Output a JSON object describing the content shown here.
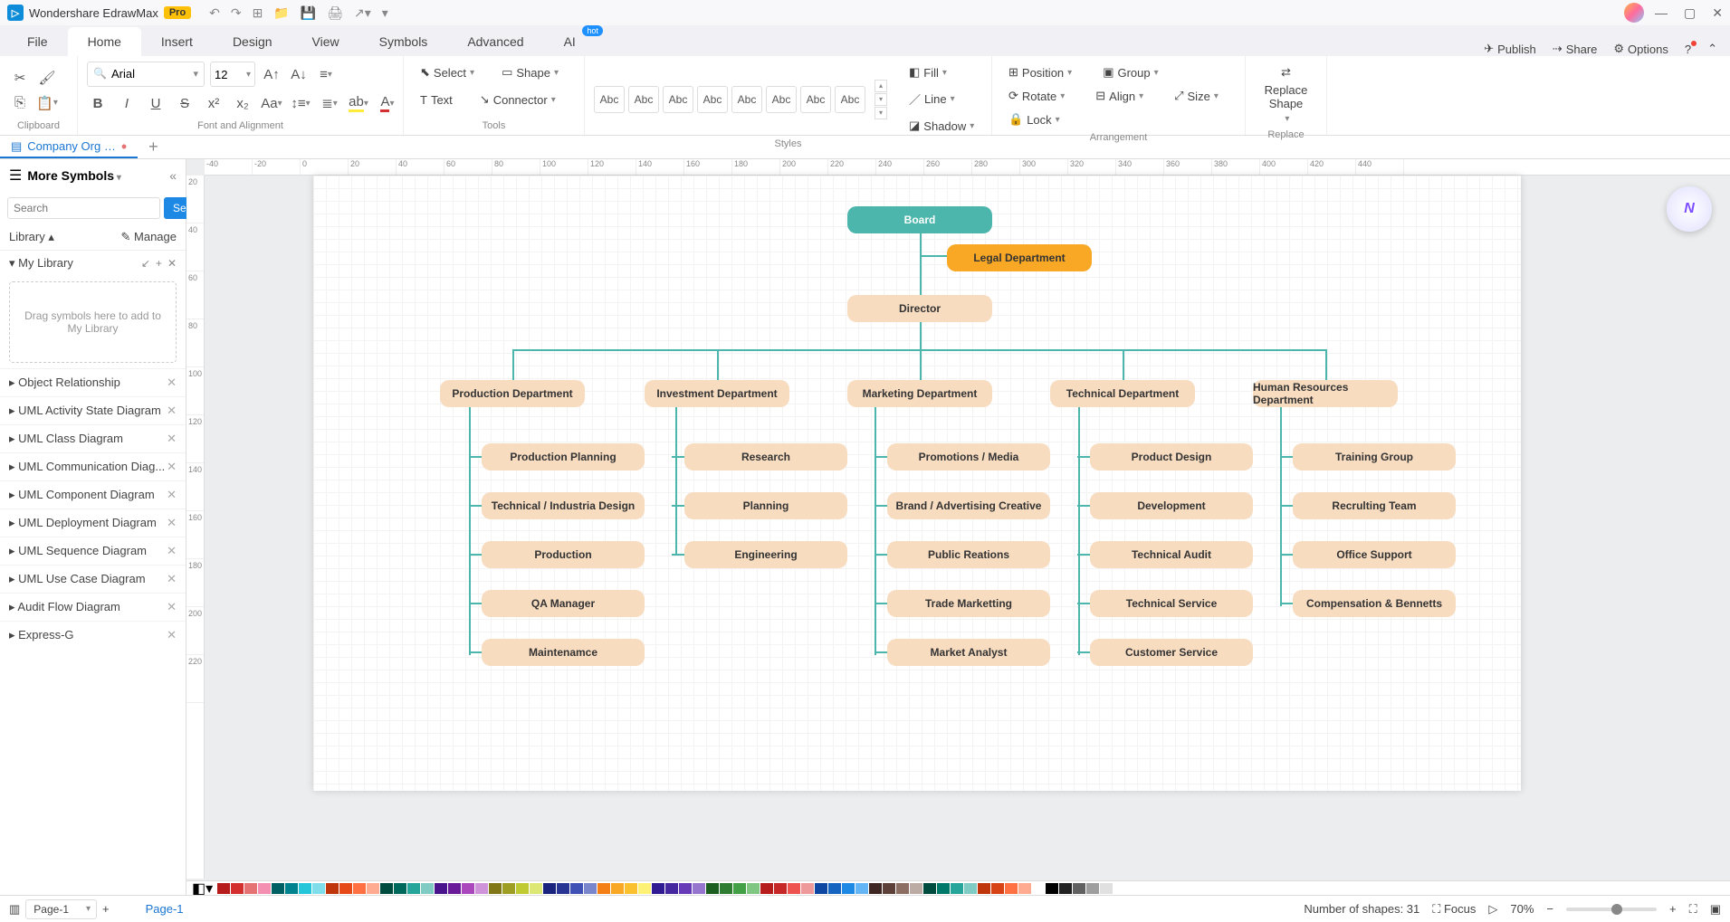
{
  "titlebar": {
    "app_name": "Wondershare EdrawMax",
    "pro": "Pro"
  },
  "menu": {
    "file": "File",
    "home": "Home",
    "insert": "Insert",
    "design": "Design",
    "view": "View",
    "symbols": "Symbols",
    "advanced": "Advanced",
    "ai": "AI",
    "hot": "hot",
    "publish": "Publish",
    "share": "Share",
    "options": "Options"
  },
  "ribbon": {
    "font_name": "Arial",
    "font_size": "12",
    "clipboard": "Clipboard",
    "font_align": "Font and Alignment",
    "tools": "Tools",
    "styles": "Styles",
    "arrangement": "Arrangement",
    "replace": "Replace",
    "select": "Select",
    "shape": "Shape",
    "text": "Text",
    "connector": "Connector",
    "fill": "Fill",
    "line": "Line",
    "shadow": "Shadow",
    "position": "Position",
    "group": "Group",
    "rotate": "Rotate",
    "align": "Align",
    "size": "Size",
    "lock": "Lock",
    "replace_shape": "Replace\nShape",
    "abc": "Abc"
  },
  "doctab": {
    "name": "Company Org …"
  },
  "sidebar": {
    "title": "More Symbols",
    "search_ph": "Search",
    "search_btn": "Search",
    "library": "Library",
    "manage": "Manage",
    "mylib": "My Library",
    "drop_hint": "Drag symbols here to add to My Library",
    "items": [
      "Object Relationship",
      "UML Activity State Diagram",
      "UML Class Diagram",
      "UML Communication Diag...",
      "UML Component Diagram",
      "UML Deployment Diagram",
      "UML Sequence Diagram",
      "UML Use Case Diagram",
      "Audit Flow Diagram",
      "Express-G"
    ]
  },
  "ruler_h": [
    "-40",
    "-20",
    "0",
    "20",
    "40",
    "60",
    "80",
    "100",
    "120",
    "140",
    "160",
    "180",
    "200",
    "220",
    "240",
    "260",
    "280",
    "300",
    "320",
    "340",
    "360",
    "380",
    "400",
    "420",
    "440"
  ],
  "ruler_v": [
    "20",
    "40",
    "60",
    "80",
    "100",
    "120",
    "140",
    "160",
    "180",
    "200",
    "220"
  ],
  "org": {
    "board": "Board",
    "legal": "Legal  Department",
    "director": "Director",
    "depts": [
      "Production Department",
      "Investment Department",
      "Marketing Department",
      "Technical Department",
      "Human Resources Department"
    ],
    "col0": [
      "Production Planning",
      "Technical / Industria Design",
      "Production",
      "QA Manager",
      "Maintenamce"
    ],
    "col1": [
      "Research",
      "Planning",
      "Engineering"
    ],
    "col2": [
      "Promotions / Media",
      "Brand / Advertising Creative",
      "Public Reations",
      "Trade Marketting",
      "Market Analyst"
    ],
    "col3": [
      "Product Design",
      "Development",
      "Technical Audit",
      "Technical Service",
      "Customer Service"
    ],
    "col4": [
      "Training Group",
      "Recrulting Team",
      "Office Support",
      "Compensation & Bennetts"
    ]
  },
  "status": {
    "page_sel": "Page-1",
    "page_link": "Page-1",
    "shapes": "Number of shapes: 31",
    "focus": "Focus",
    "zoom": "70%"
  },
  "colors": [
    "#b71c1c",
    "#d32f2f",
    "#e57373",
    "#f48fb1",
    "#006064",
    "#00838f",
    "#26c6da",
    "#80deea",
    "#bf360c",
    "#e64a19",
    "#ff7043",
    "#ffab91",
    "#004d40",
    "#00695c",
    "#26a69a",
    "#80cbc4",
    "#4a148c",
    "#6a1b9a",
    "#ab47bc",
    "#ce93d8",
    "#827717",
    "#9e9d24",
    "#c0ca33",
    "#dce775",
    "#1a237e",
    "#283593",
    "#3f51b5",
    "#7986cb",
    "#f57f17",
    "#f9a825",
    "#fbc02d",
    "#fff176",
    "#311b92",
    "#4527a0",
    "#673ab7",
    "#9575cd",
    "#1b5e20",
    "#2e7d32",
    "#43a047",
    "#81c784",
    "#b71c1c",
    "#c62828",
    "#ef5350",
    "#ef9a9a",
    "#0d47a1",
    "#1565c0",
    "#1e88e5",
    "#64b5f6",
    "#3e2723",
    "#5d4037",
    "#8d6e63",
    "#bcaaa4",
    "#004d40",
    "#00796b",
    "#26a69a",
    "#80cbc4",
    "#bf360c",
    "#d84315",
    "#ff7043",
    "#ffab91",
    "#ffffff",
    "#000000",
    "#212121",
    "#616161",
    "#9e9e9e",
    "#e0e0e0"
  ]
}
